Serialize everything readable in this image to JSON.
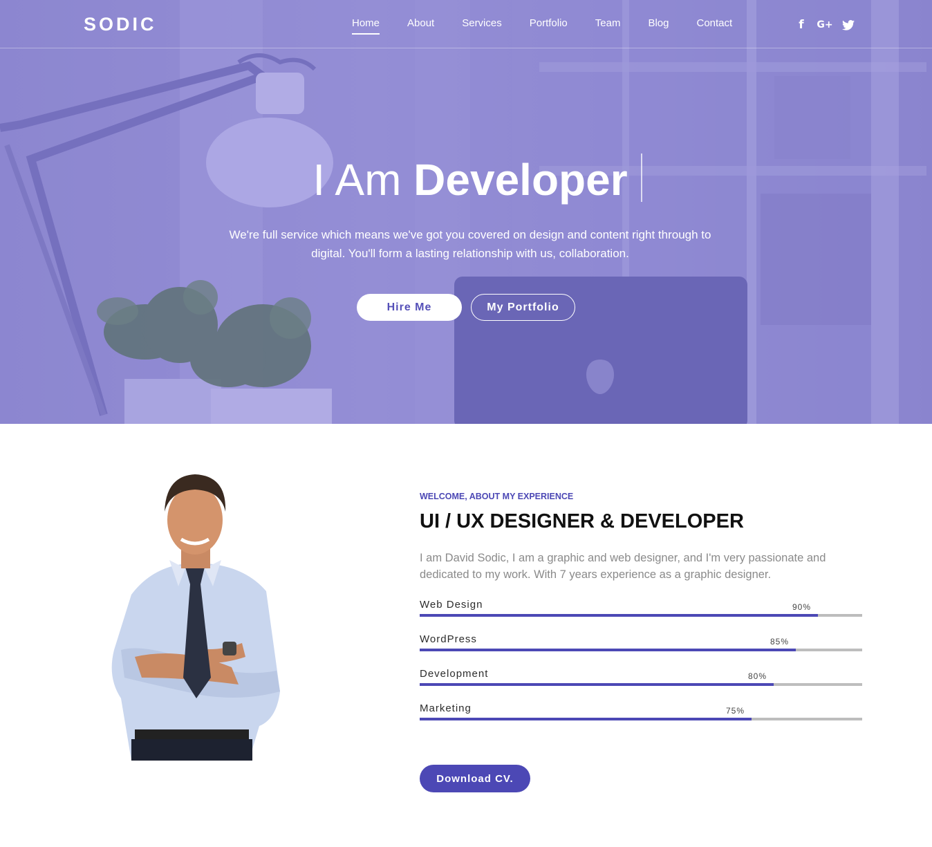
{
  "nav": {
    "logo": "SODIC",
    "items": [
      {
        "label": "Home",
        "active": true
      },
      {
        "label": "About"
      },
      {
        "label": "Services"
      },
      {
        "label": "Portfolio"
      },
      {
        "label": "Team"
      },
      {
        "label": "Blog"
      },
      {
        "label": "Contact"
      }
    ],
    "social": [
      "facebook-icon",
      "google-plus-icon",
      "twitter-icon"
    ],
    "social_glyphs": {
      "facebook": "f",
      "google": "G+"
    }
  },
  "hero": {
    "title_light": "I Am",
    "title_bold": "Developer",
    "subtitle": "We're full service which means we've got you covered on design and content right through to digital. You'll form a lasting relationship with us, collaboration.",
    "hire_label": "Hire Me",
    "portfolio_label": "My Portfolio",
    "overlay_color": "#8a84d0"
  },
  "about": {
    "eyebrow": "WELCOME, ABOUT MY EXPERIENCE",
    "title": "UI / UX DESIGNER & DEVELOPER",
    "text": "I am David Sodic, I am a graphic and web designer, and I'm very passionate and dedicated to my work. With 7 years experience as a graphic designer.",
    "skills": [
      {
        "name": "Web Design",
        "percent": 90,
        "label": "90%"
      },
      {
        "name": "WordPress",
        "percent": 85,
        "label": "85%"
      },
      {
        "name": "Development",
        "percent": 80,
        "label": "80%"
      },
      {
        "name": "Marketing",
        "percent": 75,
        "label": "75%"
      }
    ],
    "cv_label": "Download CV.",
    "accent": "#4c48b5"
  }
}
